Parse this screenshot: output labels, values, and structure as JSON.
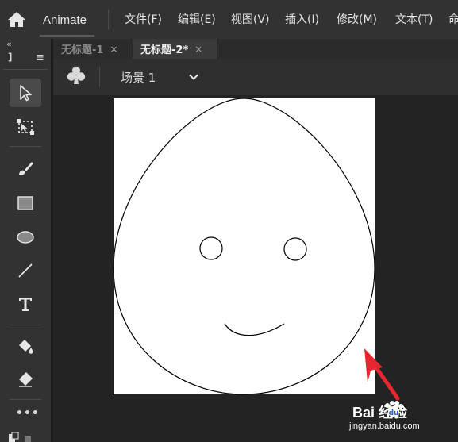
{
  "app": {
    "name": "Animate"
  },
  "menu": {
    "items": [
      {
        "label": "文件(F)"
      },
      {
        "label": "编辑(E)"
      },
      {
        "label": "视图(V)"
      },
      {
        "label": "插入(I)"
      },
      {
        "label": "修改(M)"
      },
      {
        "label": "文本(T)"
      },
      {
        "label": "命"
      }
    ]
  },
  "tool_panel": {
    "collapse": "«",
    "label": "]",
    "menu_glyph": "≡",
    "tools": [
      {
        "icon": "selection-arrow-icon",
        "active": true
      },
      {
        "icon": "free-transform-icon",
        "active": false
      },
      {
        "icon": "brush-icon",
        "active": false
      },
      {
        "icon": "rectangle-icon",
        "active": false
      },
      {
        "icon": "oval-icon",
        "active": false
      },
      {
        "icon": "line-icon",
        "active": false
      },
      {
        "icon": "text-tool-icon",
        "active": false
      },
      {
        "icon": "paint-bucket-icon",
        "active": false
      },
      {
        "icon": "eraser-icon",
        "active": false
      }
    ],
    "more_label": "•••"
  },
  "tabs": [
    {
      "label": "无标题-1",
      "active": false,
      "close": "×"
    },
    {
      "label": "无标题-2*",
      "active": true,
      "close": "×"
    }
  ],
  "scene": {
    "label": "场景 1",
    "icon": "club-icon"
  },
  "colors": {
    "arrow": "#e8262f",
    "stage": "#ffffff",
    "stroke": "#000000",
    "background": "#232323"
  },
  "watermark": {
    "text": "Bai  经验",
    "url": "jingyan.baidu.com"
  }
}
